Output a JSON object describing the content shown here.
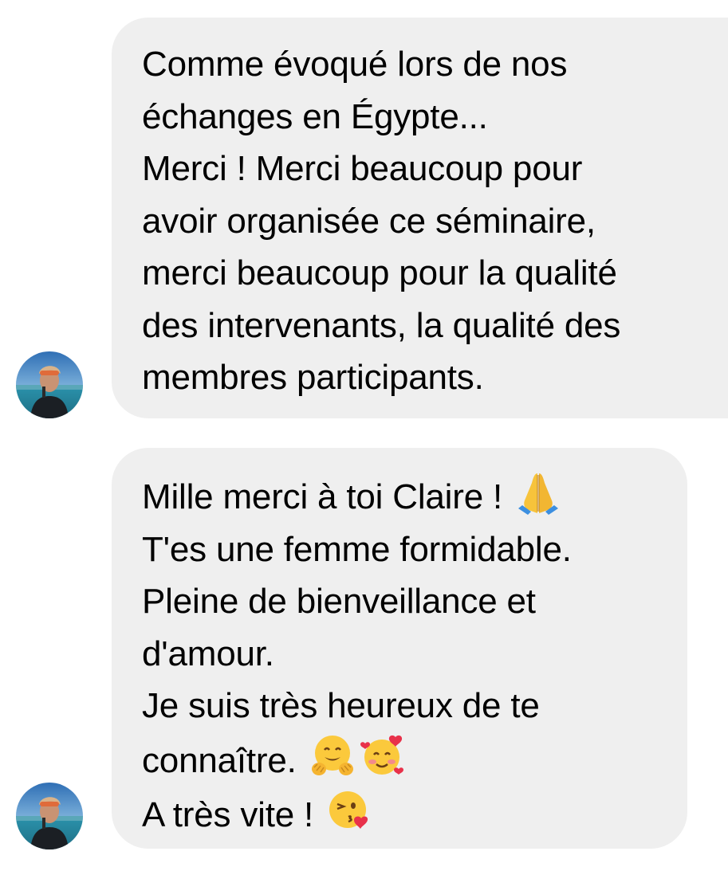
{
  "messages": [
    {
      "lines": [
        "Comme évoqué lors de nos",
        "échanges en Égypte...",
        "Merci ! Merci beaucoup pour",
        "avoir organisée ce séminaire,",
        "merci beaucoup pour la qualité",
        "des intervenants, la qualité des",
        "membres participants."
      ],
      "avatar_icon": "sender-avatar"
    },
    {
      "lines": [
        "Mille merci à toi Claire !",
        "T'es une femme formidable.",
        "Pleine de bienveillance et",
        "d'amour.",
        "Je suis très heureux de te",
        "connaître.",
        "A très vite !"
      ],
      "emojis": {
        "line_1": [
          "folded-hands-emoji"
        ],
        "line_6": [
          "hugging-face-emoji",
          "smiling-face-with-hearts-emoji"
        ],
        "line_7": [
          "face-blowing-kiss-emoji"
        ]
      },
      "avatar_icon": "sender-avatar"
    }
  ],
  "colors": {
    "bubble_background": "#efefef",
    "text": "#000000",
    "page_background": "#ffffff"
  }
}
